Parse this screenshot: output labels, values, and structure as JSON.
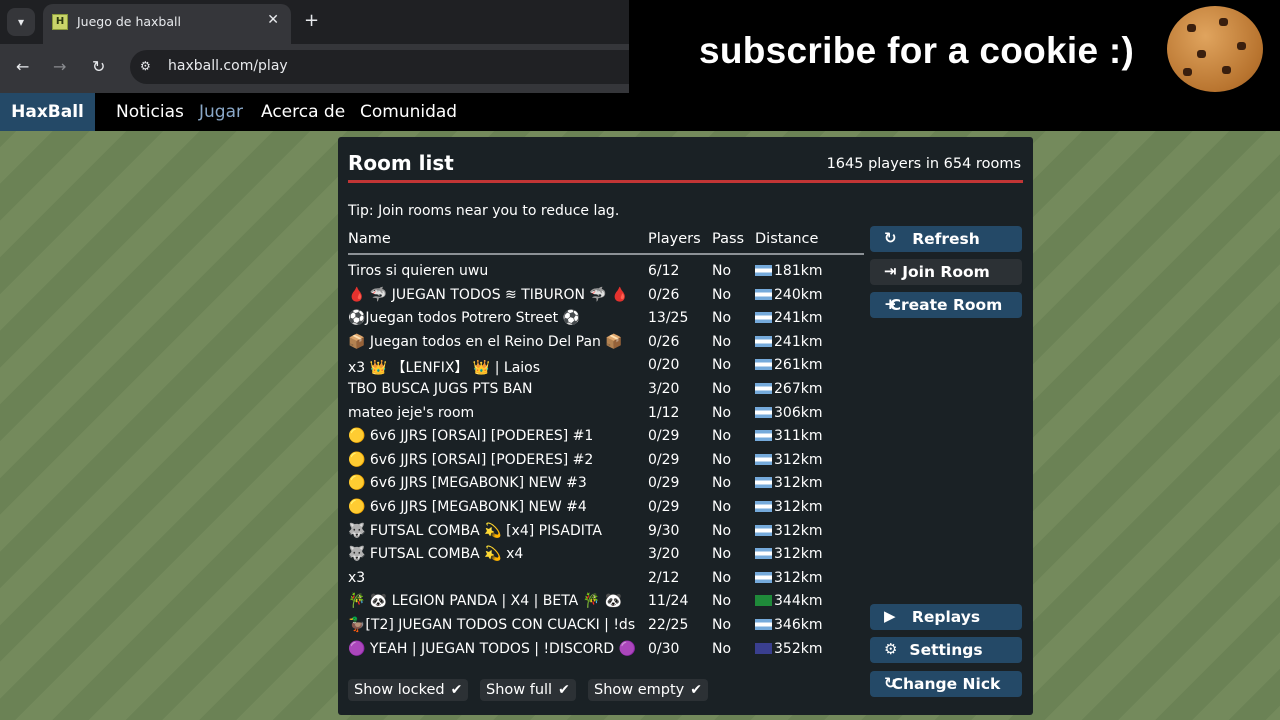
{
  "browser": {
    "tab_title": "Juego de haxball",
    "favicon_letter": "H",
    "close": "✕",
    "new_tab": "+",
    "url": "haxball.com/play"
  },
  "banner": {
    "text": "subscribe for a cookie :)"
  },
  "site": {
    "brand": "HaxBall",
    "nav": [
      {
        "label": "Noticias"
      },
      {
        "label": "Jugar",
        "active": true
      },
      {
        "label": "Acerca de"
      },
      {
        "label": "Comunidad"
      }
    ]
  },
  "room_list": {
    "title": "Room list",
    "count": "1645 players in 654 rooms",
    "tip": "Tip: Join rooms near you to reduce lag.",
    "columns": {
      "name": "Name",
      "players": "Players",
      "pass": "Pass",
      "distance": "Distance"
    },
    "rooms": [
      {
        "name": "Tiros si quieren uwu",
        "players": "6/12",
        "pass": "No",
        "distance": "181km"
      },
      {
        "name": "🩸 🦈 JUEGAN TODOS ≋ TIBURON 🦈 🩸",
        "players": "0/26",
        "pass": "No",
        "distance": "240km"
      },
      {
        "name": "⚽Juegan todos Potrero Street ⚽",
        "players": "13/25",
        "pass": "No",
        "distance": "241km"
      },
      {
        "name": "📦 Juegan todos en el Reino Del Pan 📦",
        "players": "0/26",
        "pass": "No",
        "distance": "241km"
      },
      {
        "name": "x3 👑 【LENFIX】 👑 | Laios",
        "players": "0/20",
        "pass": "No",
        "distance": "261km"
      },
      {
        "name": "TBO BUSCA JUGS PTS BAN",
        "players": "3/20",
        "pass": "No",
        "distance": "267km"
      },
      {
        "name": "mateo jeje's room",
        "players": "1/12",
        "pass": "No",
        "distance": "306km"
      },
      {
        "name": "🟡       6v6 JJRS [ORSAI] [PODERES] #1",
        "players": "0/29",
        "pass": "No",
        "distance": "311km"
      },
      {
        "name": "🟡       6v6 JJRS [ORSAI] [PODERES] #2",
        "players": "0/29",
        "pass": "No",
        "distance": "312km"
      },
      {
        "name": "🟡       6v6 JJRS [MEGABONK] NEW #3",
        "players": "0/29",
        "pass": "No",
        "distance": "312km"
      },
      {
        "name": "🟡       6v6 JJRS [MEGABONK] NEW #4",
        "players": "0/29",
        "pass": "No",
        "distance": "312km"
      },
      {
        "name": "🐺 FUTSAL COMBA 💫 [x4] PISADITA",
        "players": "9/30",
        "pass": "No",
        "distance": "312km"
      },
      {
        "name": "🐺 FUTSAL COMBA 💫 x4",
        "players": "3/20",
        "pass": "No",
        "distance": "312km"
      },
      {
        "name": "x3",
        "players": "2/12",
        "pass": "No",
        "distance": "312km"
      },
      {
        "name": "🎋 🐼 LEGION PANDA | X4 | BETA 🎋 🐼",
        "players": "11/24",
        "pass": "No",
        "distance": "344km",
        "flag": "green"
      },
      {
        "name": "🦆[T2] JUEGAN TODOS CON CUACKI | !ds",
        "players": "22/25",
        "pass": "No",
        "distance": "346km"
      },
      {
        "name": "🟣 YEAH | JUEGAN TODOS | !DISCORD 🟣",
        "players": "0/30",
        "pass": "No",
        "distance": "352km",
        "flag": "navy"
      }
    ],
    "buttons": {
      "refresh": "Refresh",
      "join": "Join Room",
      "create": "Create Room",
      "replays": "Replays",
      "settings": "Settings",
      "change_nick": "Change Nick"
    },
    "filters": {
      "locked": "Show locked",
      "full": "Show full",
      "empty": "Show empty"
    }
  },
  "colors": {
    "accent_red": "#c13535",
    "button_blue": "#244967",
    "dialog_bg": "#1a2125"
  }
}
